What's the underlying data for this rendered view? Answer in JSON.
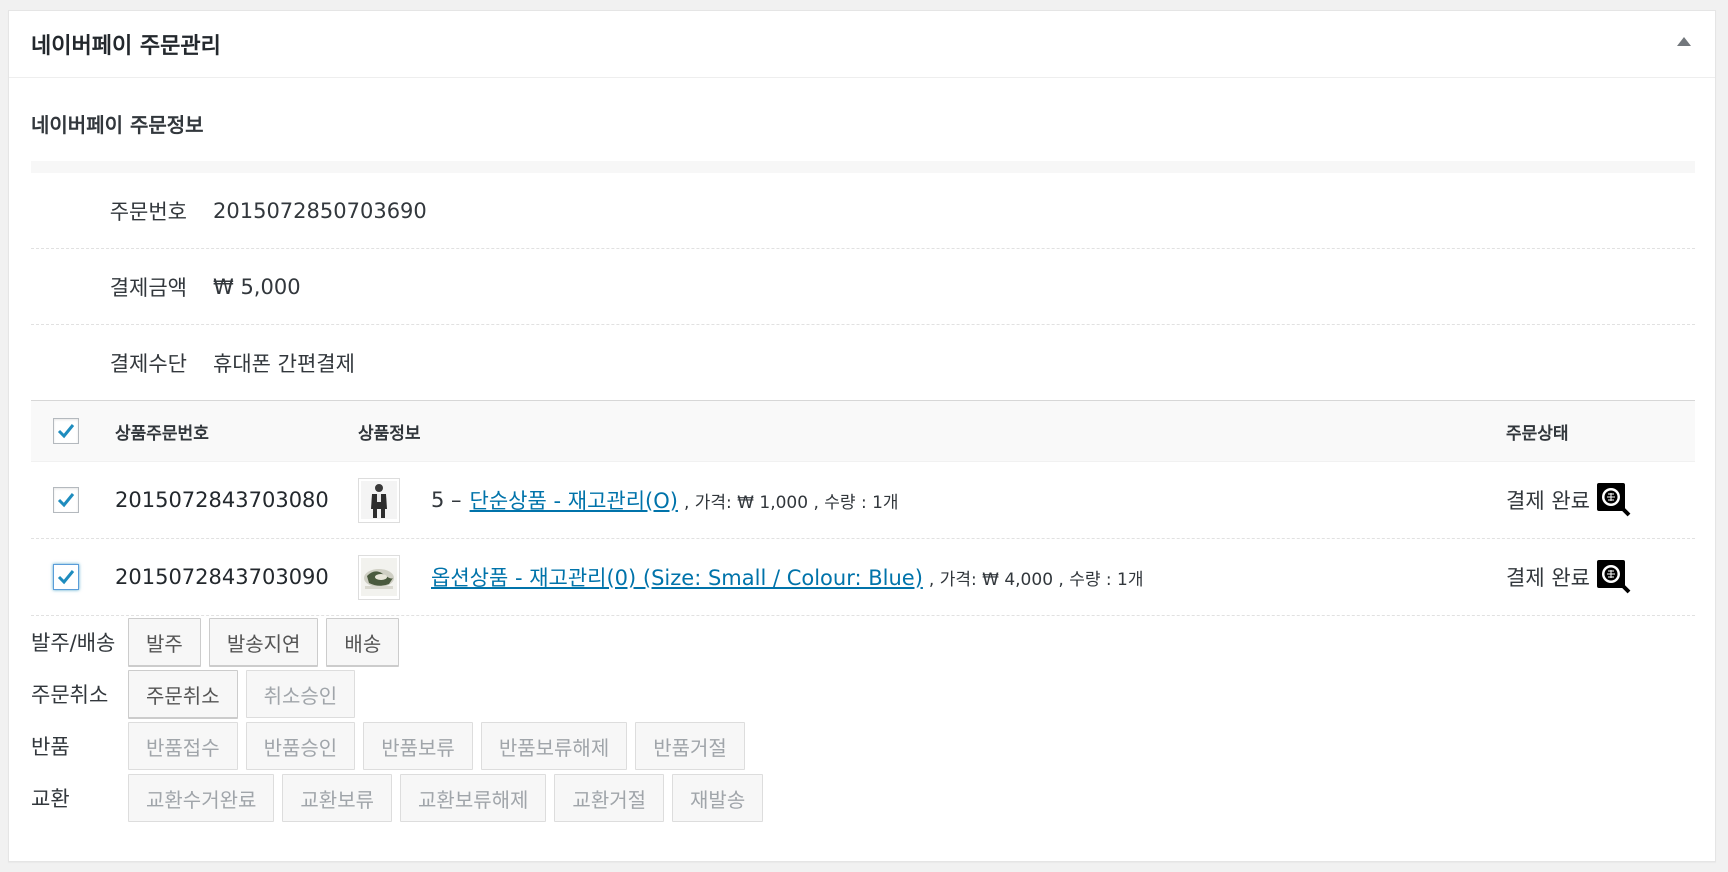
{
  "metabox": {
    "title": "네이버페이 주문관리",
    "section_title": "네이버페이 주문정보"
  },
  "order_info": [
    {
      "label": "주문번호",
      "value": "2015072850703690"
    },
    {
      "label": "결제금액",
      "value": "₩ 5,000"
    },
    {
      "label": "결제수단",
      "value": "휴대폰 간편결제"
    }
  ],
  "items_table": {
    "headers": {
      "product_order_no": "상품주문번호",
      "product_info": "상품정보",
      "order_status": "주문상태"
    },
    "rows": [
      {
        "checked": true,
        "product_order_no": "2015072843703080",
        "prefix": "5 –",
        "product_name": "단순상품 - 재고관리(O)",
        "meta": ", 가격: ₩ 1,000 , 수량 : 1개",
        "status": "결제 완료",
        "thumb_icon": "person-photo-icon"
      },
      {
        "checked": true,
        "product_order_no": "2015072843703090",
        "prefix": "",
        "product_name": "옵션상품 - 재고관리(0) (Size: Small / Colour: Blue)",
        "meta": ", 가격: ₩ 4,000 , 수량 : 1개",
        "status": "결제 완료",
        "thumb_icon": "product-photo-icon"
      }
    ]
  },
  "actions": [
    {
      "label": "발주/배송",
      "buttons": [
        {
          "text": "발주",
          "enabled": true
        },
        {
          "text": "발송지연",
          "enabled": true
        },
        {
          "text": "배송",
          "enabled": true
        }
      ]
    },
    {
      "label": "주문취소",
      "buttons": [
        {
          "text": "주문취소",
          "enabled": true
        },
        {
          "text": "취소승인",
          "enabled": false
        }
      ]
    },
    {
      "label": "반품",
      "buttons": [
        {
          "text": "반품접수",
          "enabled": false
        },
        {
          "text": "반품승인",
          "enabled": false
        },
        {
          "text": "반품보류",
          "enabled": false
        },
        {
          "text": "반품보류해제",
          "enabled": false
        },
        {
          "text": "반품거절",
          "enabled": false
        }
      ]
    },
    {
      "label": "교환",
      "buttons": [
        {
          "text": "교환수거완료",
          "enabled": false
        },
        {
          "text": "교환보류",
          "enabled": false
        },
        {
          "text": "교환보류해제",
          "enabled": false
        },
        {
          "text": "교환거절",
          "enabled": false
        },
        {
          "text": "재발송",
          "enabled": false
        }
      ]
    }
  ],
  "colors": {
    "link": "#0073aa",
    "checkmark": "#1e8cbe"
  }
}
